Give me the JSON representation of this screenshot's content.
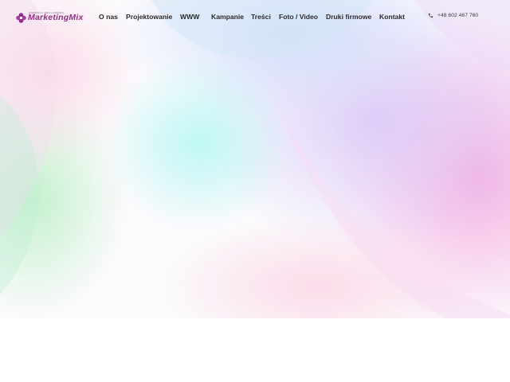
{
  "brand": {
    "logo_word": "MarketingMix",
    "logo_tagline": "AGENCJA REKLAMOWA",
    "color": "#8e2f86"
  },
  "nav": {
    "items": [
      {
        "label": "O nas"
      },
      {
        "label": "Projektowanie"
      },
      {
        "label": "WWW"
      },
      {
        "label": "Kampanie"
      },
      {
        "label": "Treści"
      },
      {
        "label": "Foto / Video"
      },
      {
        "label": "Druki firmowe"
      },
      {
        "label": "Kontakt"
      }
    ]
  },
  "contact": {
    "phone": "+48 602 467 760",
    "icon": "phone-icon"
  },
  "colors": {
    "text": "#2b2b2b",
    "hero_pink": "#f5a6dc",
    "hero_cyan": "#b8f3f3",
    "hero_violet": "#d9c8f5",
    "hero_green": "#c9f0cf"
  }
}
